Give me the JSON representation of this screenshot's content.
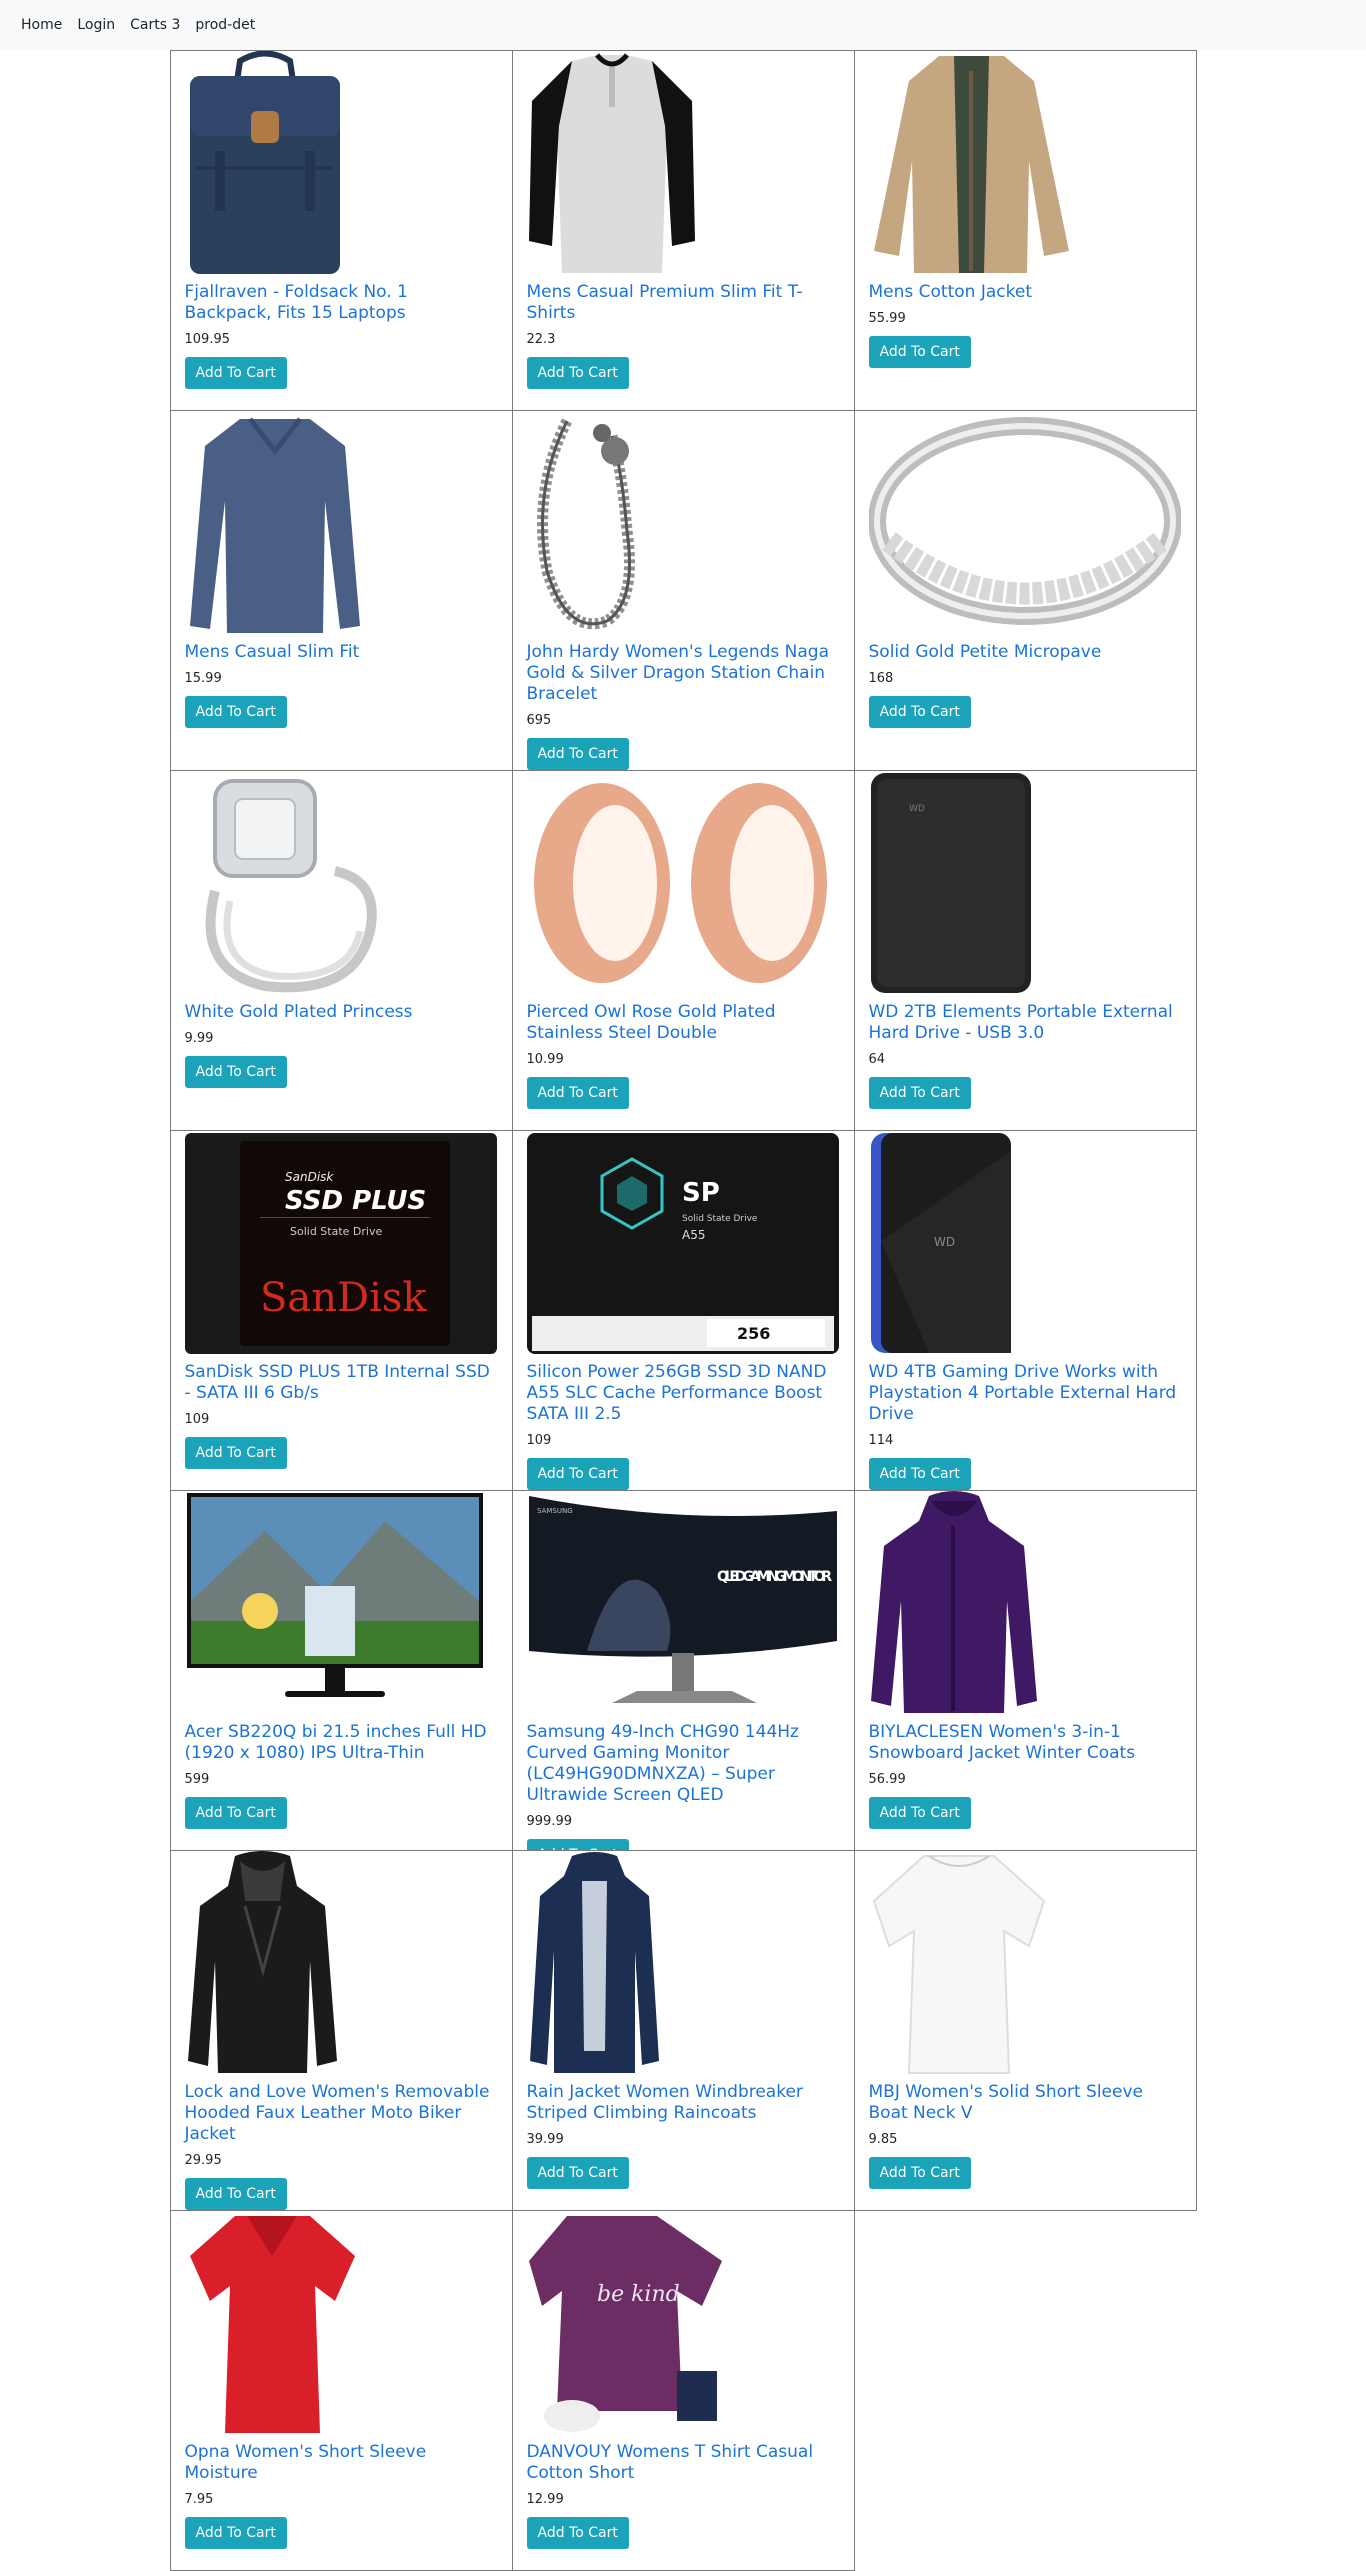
{
  "nav": {
    "home": "Home",
    "login": "Login",
    "carts": "Carts 3",
    "prod_det": "prod-det"
  },
  "products": [
    {
      "title": "Fjallraven - Foldsack No. 1 Backpack, Fits 15 Laptops",
      "price": "109.95",
      "button": "Add To Cart"
    },
    {
      "title": "Mens Casual Premium Slim Fit T-Shirts",
      "price": "22.3",
      "button": "Add To Cart"
    },
    {
      "title": "Mens Cotton Jacket",
      "price": "55.99",
      "button": "Add To Cart"
    },
    {
      "title": "Mens Casual Slim Fit",
      "price": "15.99",
      "button": "Add To Cart"
    },
    {
      "title": "John Hardy Women's Legends Naga Gold & Silver Dragon Station Chain Bracelet",
      "price": "695",
      "button": "Add To Cart"
    },
    {
      "title": "Solid Gold Petite Micropave",
      "price": "168",
      "button": "Add To Cart"
    },
    {
      "title": "White Gold Plated Princess",
      "price": "9.99",
      "button": "Add To Cart"
    },
    {
      "title": "Pierced Owl Rose Gold Plated Stainless Steel Double",
      "price": "10.99",
      "button": "Add To Cart"
    },
    {
      "title": "WD 2TB Elements Portable External Hard Drive - USB 3.0",
      "price": "64",
      "button": "Add To Cart"
    },
    {
      "title": "SanDisk SSD PLUS 1TB Internal SSD - SATA III 6 Gb/s",
      "price": "109",
      "button": "Add To Cart"
    },
    {
      "title": "Silicon Power 256GB SSD 3D NAND A55 SLC Cache Performance Boost SATA III 2.5",
      "price": "109",
      "button": "Add To Cart"
    },
    {
      "title": "WD 4TB Gaming Drive Works with Playstation 4 Portable External Hard Drive",
      "price": "114",
      "button": "Add To Cart"
    },
    {
      "title": "Acer SB220Q bi 21.5 inches Full HD (1920 x 1080) IPS Ultra-Thin",
      "price": "599",
      "button": "Add To Cart"
    },
    {
      "title": "Samsung 49-Inch CHG90 144Hz Curved Gaming Monitor (LC49HG90DMNXZA) – Super Ultrawide Screen QLED",
      "price": "999.99",
      "button": "Add To Cart"
    },
    {
      "title": "BIYLACLESEN Women's 3-in-1 Snowboard Jacket Winter Coats",
      "price": "56.99",
      "button": "Add To Cart"
    },
    {
      "title": "Lock and Love Women's Removable Hooded Faux Leather Moto Biker Jacket",
      "price": "29.95",
      "button": "Add To Cart"
    },
    {
      "title": "Rain Jacket Women Windbreaker Striped Climbing Raincoats",
      "price": "39.99",
      "button": "Add To Cart"
    },
    {
      "title": "MBJ Women's Solid Short Sleeve Boat Neck V",
      "price": "9.85",
      "button": "Add To Cart"
    },
    {
      "title": "Opna Women's Short Sleeve Moisture",
      "price": "7.95",
      "button": "Add To Cart"
    },
    {
      "title": "DANVOUY Womens T Shirt Casual Cotton Short",
      "price": "12.99",
      "button": "Add To Cart"
    }
  ],
  "image_text": {
    "sandisk_brand_small": "SanDisk",
    "sandisk_ssd_plus": "SSD PLUS",
    "sandisk_ssd_sub": "Solid State Drive",
    "sandisk_logo": "SanDisk",
    "sp_logo": "SP",
    "sp_sub": "Solid State Drive",
    "sp_model": "A55",
    "sp_capacity": "256",
    "samsung_brand": "SAMSUNG",
    "qled_text": "QLED GAMING MONITOR",
    "wd_text": "WD",
    "tee_text": "be kind"
  }
}
